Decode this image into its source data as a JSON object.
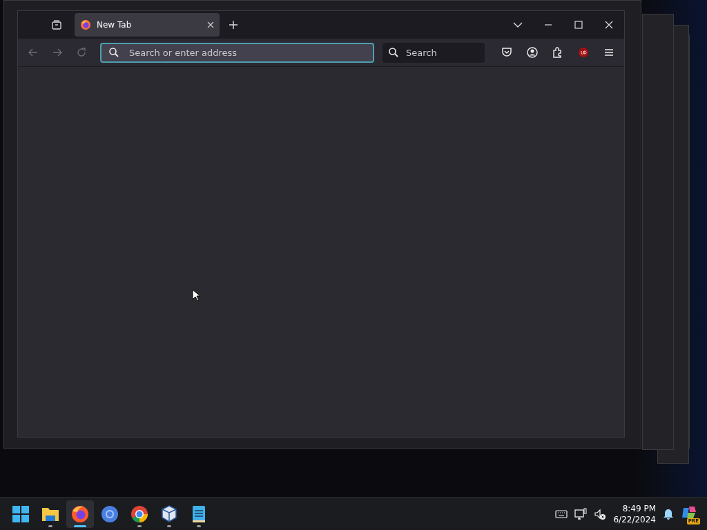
{
  "browser": {
    "tabs": [
      {
        "label": "New Tab",
        "selected": true
      }
    ],
    "nav_buttons": [
      {
        "kind": "back",
        "disabled": true
      },
      {
        "kind": "forward",
        "disabled": true
      },
      {
        "kind": "reload",
        "disabled": true
      }
    ],
    "address_bar": {
      "placeholder": "Search or enter address",
      "focused": true
    },
    "search_field": {
      "placeholder": "Search"
    }
  },
  "taskbar": {
    "apps": [
      {
        "kind": "start",
        "running": false,
        "active": false
      },
      {
        "kind": "explorer",
        "running": true,
        "active": false
      },
      {
        "kind": "firefox",
        "running": true,
        "active": true
      },
      {
        "kind": "chromium",
        "running": false,
        "active": false
      },
      {
        "kind": "chrome",
        "running": true,
        "active": false
      },
      {
        "kind": "virtualbox",
        "running": true,
        "active": false
      },
      {
        "kind": "notepad",
        "running": true,
        "active": false
      }
    ],
    "tray": {
      "time": "8:49 PM",
      "date": "6/22/2024",
      "copilot_badge": "PRE"
    }
  }
}
